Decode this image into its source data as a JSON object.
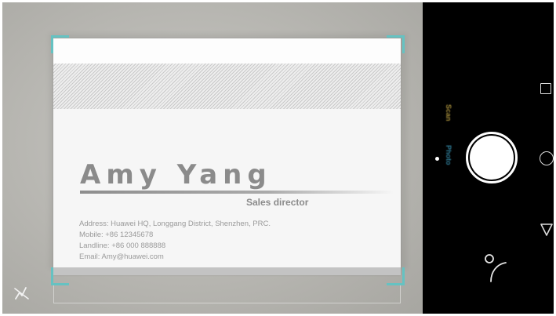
{
  "card": {
    "name": "Amy Yang",
    "title": "Sales director",
    "address": "Address: Huawei HQ, Longgang District, Shenzhen, PRC.",
    "mobile": "Mobile: +86 12345678",
    "landline": "Landline: +86 000 888888",
    "email": "Email: Amy@huawei.com"
  },
  "camera": {
    "modes": [
      "Scan",
      "Photo"
    ],
    "flash_icon": "flash-off-icon",
    "switch_icon": "switch-camera-icon",
    "shutter_icon": "shutter-button"
  },
  "navigation": {
    "recents_icon": "square-icon",
    "home_icon": "circle-icon",
    "back_icon": "triangle-back-icon"
  },
  "colors": {
    "frame_accent": "#65c2c2",
    "control_bg": "#000000",
    "card_text": "#8b8b8b"
  }
}
